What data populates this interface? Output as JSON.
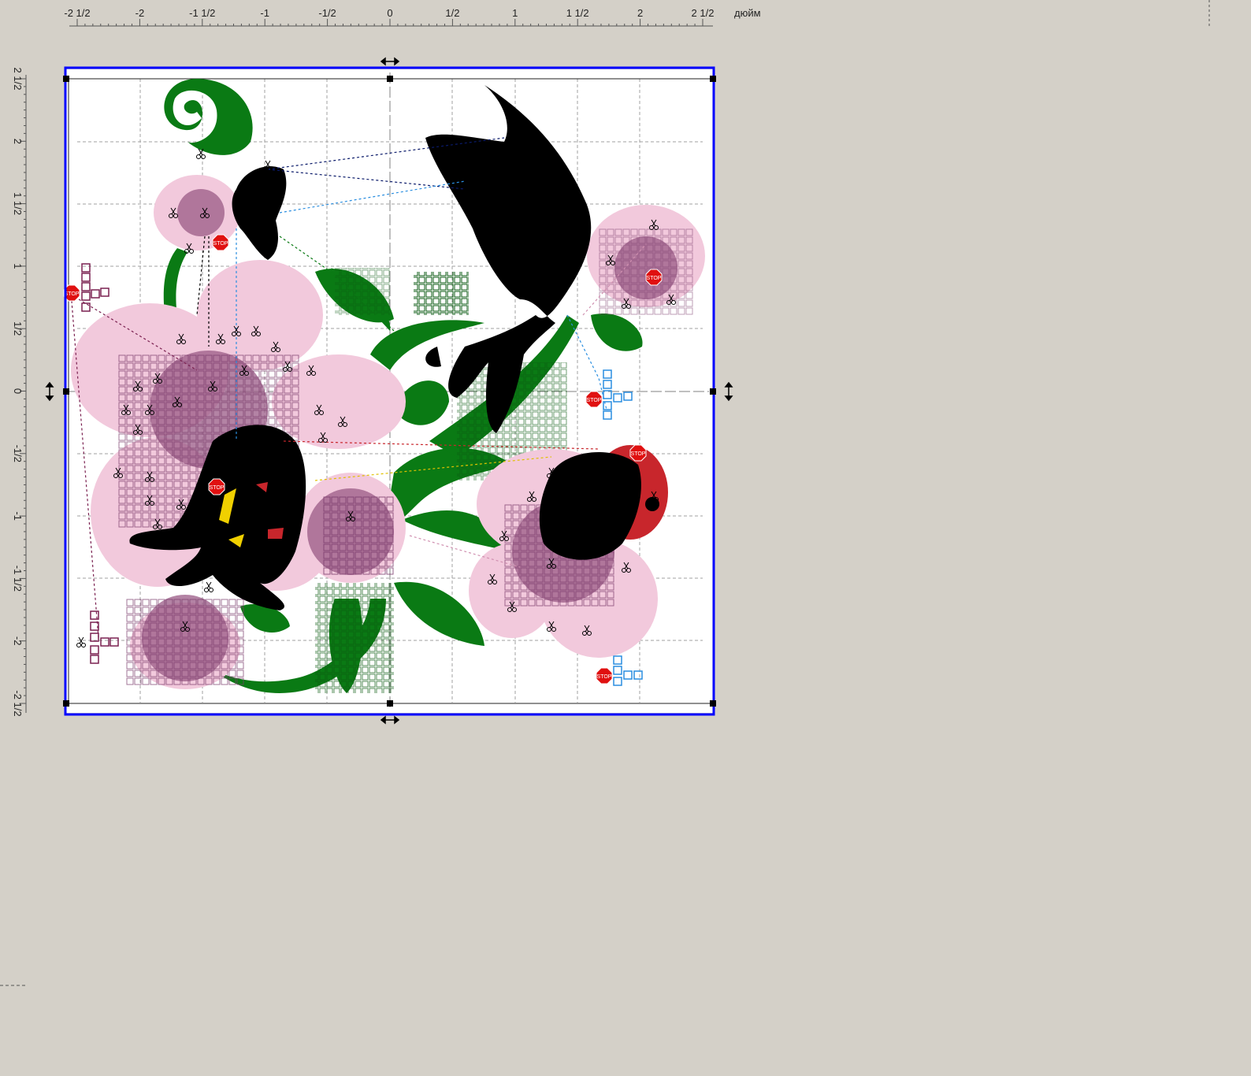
{
  "rulers": {
    "unit_label": "дюйм",
    "top_ticks": [
      "-2 1/2",
      "-2",
      "-1 1/2",
      "-1",
      "-1/2",
      "0",
      "1/2",
      "1",
      "1 1/2",
      "2",
      "2 1/2"
    ],
    "left_ticks": [
      "2 1/2",
      "2",
      "1 1/2",
      "1",
      "1/2",
      "0",
      "-1/2",
      "-1",
      "-1 1/2",
      "-2",
      "-2 1/2"
    ]
  },
  "design": {
    "hoop_border_color": "#0000ff",
    "grid_color": "#a0a0a0",
    "colors": {
      "leaf_green": "#0a7a14",
      "petal_pink": "#f2c9dc",
      "petal_mauve": "#9a5a85",
      "butterfly_black": "#000000",
      "ladybug_red": "#c8262c",
      "stop_red": "#e01010",
      "marker_blue": "#2a8ee0",
      "marker_purple": "#7a2050"
    },
    "icons": [
      "stop-marker-icon",
      "scissors-icon",
      "resize-arrow-icon",
      "selection-handle-icon"
    ]
  }
}
